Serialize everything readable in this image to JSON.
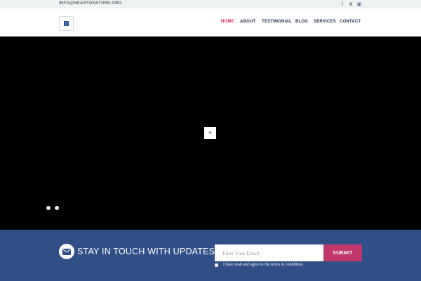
{
  "topbar": {
    "email": "INFO@NEARTONATURE.ORG",
    "social": [
      {
        "icon": "facebook-icon",
        "glyph": "f"
      },
      {
        "icon": "twitter-icon",
        "glyph": "❦"
      },
      {
        "icon": "instagram-icon",
        "glyph": "▣"
      }
    ]
  },
  "nav": {
    "items": [
      {
        "label": "HOME",
        "active": true
      },
      {
        "label": "ABOUT",
        "active": false
      },
      {
        "label": "TESTIMONIAL",
        "active": false
      },
      {
        "label": "BLOG",
        "active": false
      },
      {
        "label": "SERVICES",
        "active": false
      },
      {
        "label": "CONTACT",
        "active": false
      }
    ]
  },
  "hero": {
    "loader_glyph": "✴",
    "dots": 2
  },
  "newsletter": {
    "title": "STAY IN TOUCH WITH UPDATES!",
    "input_placeholder": "Enter Your Email",
    "submit_label": "SUBMIT",
    "terms_label": "I have read and agree to the terms & conditions"
  },
  "colors": {
    "accent": "#e0245e",
    "newsletter_bg": "#2f4f86",
    "submit_bg": "#c0386b",
    "hero_bg": "#000000"
  }
}
